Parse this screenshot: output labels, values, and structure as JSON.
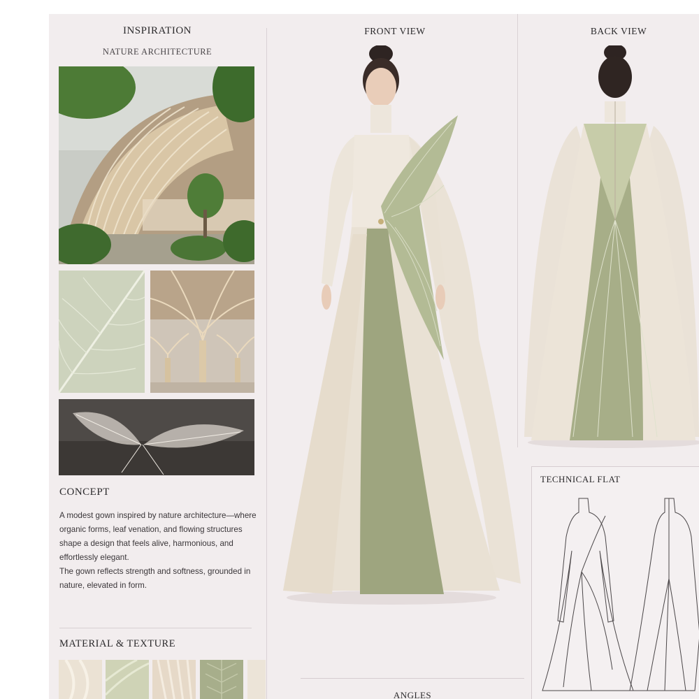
{
  "inspiration": {
    "title": "INSPIRATION",
    "subtitle": "NATURE ARCHITECTURE"
  },
  "views": {
    "front": "FRONT VIEW",
    "back": "BACK VIEW",
    "technical_flat": "TECHNICAL FLAT",
    "angles": "ANGLES"
  },
  "concept": {
    "title": "CONCEPT",
    "paragraph1": "A modest gown inspired by nature architecture—where organic forms, leaf venation, and flowing structures shape a design that feels alive, harmonious, and effortlessly elegant.",
    "paragraph2": "The gown reflects strength and softness, grounded in nature, elevated in form."
  },
  "material": {
    "title": "MATERIAL & TEXTURE"
  },
  "colors": {
    "ivory": "#ece3d6",
    "sage": "#9aa57d",
    "sage_dark": "#7e8a62",
    "sheet": "#f2edee",
    "foliage": "#4f7a3a"
  }
}
